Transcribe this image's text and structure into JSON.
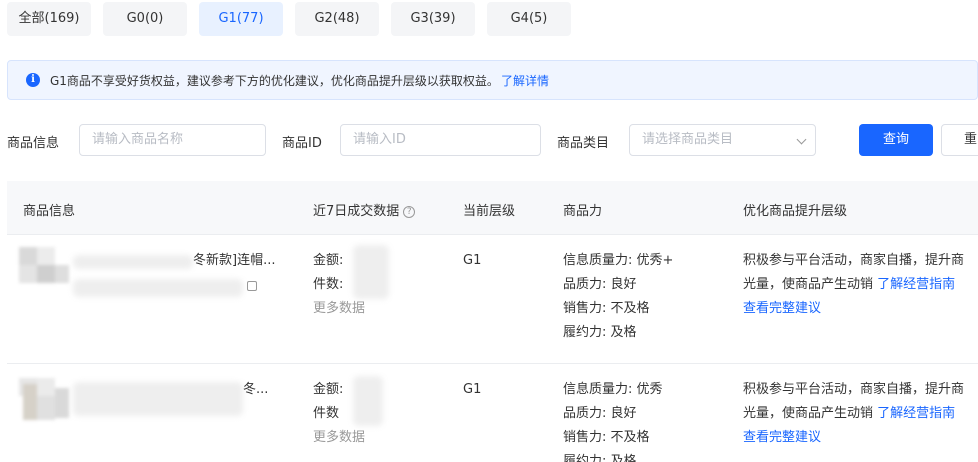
{
  "tabs": [
    {
      "label": "全部(169)"
    },
    {
      "label": "G0(0)"
    },
    {
      "label": "G1(77)"
    },
    {
      "label": "G2(48)"
    },
    {
      "label": "G3(39)"
    },
    {
      "label": "G4(5)"
    }
  ],
  "active_tab": "G1(77)",
  "banner": {
    "text": "G1商品不享受好货权益，建议参考下方的优化建议，优化商品提升层级以获取权益。",
    "link": "了解详情"
  },
  "filters": {
    "product_info_label": "商品信息",
    "product_info_placeholder": "请输入商品名称",
    "product_id_label": "商品ID",
    "product_id_placeholder": "请输入ID",
    "category_label": "商品类目",
    "category_placeholder": "请选择商品类目",
    "query_button": "查询",
    "reset_button": "重"
  },
  "table": {
    "headers": {
      "product": "商品信息",
      "sales": "近7日成交数据",
      "level": "当前层级",
      "power": "商品力",
      "optimize": "优化商品提升层级"
    },
    "rows": [
      {
        "title": "冬新款]连帽...",
        "amount_label": "金额:",
        "count_label": "件数:",
        "more_data": "更多数据",
        "level": "G1",
        "info_quality": "信息质量力: 优秀+",
        "product_quality": "品质力: 良好",
        "sales_power": "销售力: 不及格",
        "fulfillment": "履约力: 及格",
        "suggestion_line1": "积极参与平台活动，商家自播，提升商",
        "suggestion_line2": "光量，使商品产生动销",
        "guide_link": "了解经营指南",
        "full_suggestion": "查看完整建议"
      },
      {
        "title": "冬...",
        "amount_label": "金额:",
        "count_label": "件数",
        "more_data": "更多数据",
        "level": "G1",
        "info_quality": "信息质量力: 优秀",
        "product_quality": "品质力: 良好",
        "sales_power": "销售力: 不及格",
        "fulfillment": "履约力: 及格",
        "suggestion_line1": "积极参与平台活动，商家自播，提升商",
        "suggestion_line2": "光量，使商品产生动销",
        "guide_link": "了解经营指南",
        "full_suggestion": "查看完整建议"
      }
    ]
  },
  "colors": {
    "primary": "#1966ff",
    "active_tab_bg": "#e8f1ff",
    "banner_bg": "#f0f5ff"
  }
}
